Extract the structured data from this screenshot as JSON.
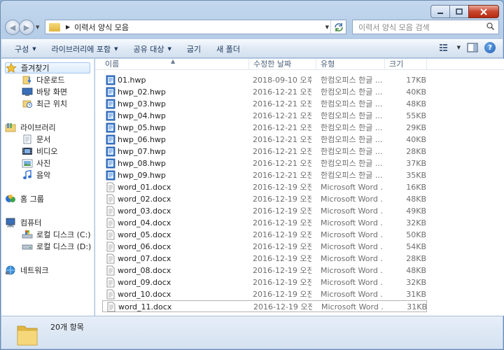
{
  "window": {
    "address_path": "이력서 양식 모음",
    "search_placeholder": "이력서 양식 모음 검색"
  },
  "toolbar": [
    {
      "label": "구성",
      "has_menu": true
    },
    {
      "label": "라이브러리에 포함",
      "has_menu": true
    },
    {
      "label": "공유 대상",
      "has_menu": true
    },
    {
      "label": "굽기",
      "has_menu": false
    },
    {
      "label": "새 폴더",
      "has_menu": false
    }
  ],
  "navigation": {
    "favorites": {
      "label": "즐겨찾기",
      "icon": "star-icon",
      "items": [
        {
          "label": "다운로드",
          "icon": "downloads-icon"
        },
        {
          "label": "바탕 화면",
          "icon": "desktop-icon"
        },
        {
          "label": "최근 위치",
          "icon": "recent-places-icon"
        }
      ]
    },
    "libraries": {
      "label": "라이브러리",
      "icon": "library-icon",
      "items": [
        {
          "label": "문서",
          "icon": "documents-icon"
        },
        {
          "label": "비디오",
          "icon": "videos-icon"
        },
        {
          "label": "사진",
          "icon": "pictures-icon"
        },
        {
          "label": "음악",
          "icon": "music-icon"
        }
      ]
    },
    "homegroup": {
      "label": "홈 그룹",
      "icon": "homegroup-icon"
    },
    "computer": {
      "label": "컴퓨터",
      "icon": "computer-icon",
      "items": [
        {
          "label": "로컬 디스크 (C:)",
          "icon": "system-drive-icon"
        },
        {
          "label": "로컬 디스크 (D:)",
          "icon": "drive-icon"
        }
      ]
    },
    "network": {
      "label": "네트워크",
      "icon": "network-icon"
    }
  },
  "columns": {
    "name": "이름",
    "date": "수정한 날짜",
    "type": "유형",
    "size": "크기"
  },
  "files": [
    {
      "name": "01.hwp",
      "date": "2018-09-10 오후 ...",
      "type": "한컴오피스 한글 ...",
      "size": "17KB",
      "icon": "hwp-file-icon"
    },
    {
      "name": "hwp_02.hwp",
      "date": "2016-12-21 오전 ...",
      "type": "한컴오피스 한글 ...",
      "size": "40KB",
      "icon": "hwp-file-icon"
    },
    {
      "name": "hwp_03.hwp",
      "date": "2016-12-21 오전 ...",
      "type": "한컴오피스 한글 ...",
      "size": "48KB",
      "icon": "hwp-file-icon"
    },
    {
      "name": "hwp_04.hwp",
      "date": "2016-12-21 오전 ...",
      "type": "한컴오피스 한글 ...",
      "size": "55KB",
      "icon": "hwp-file-icon"
    },
    {
      "name": "hwp_05.hwp",
      "date": "2016-12-21 오전 ...",
      "type": "한컴오피스 한글 ...",
      "size": "29KB",
      "icon": "hwp-file-icon"
    },
    {
      "name": "hwp_06.hwp",
      "date": "2016-12-21 오전 ...",
      "type": "한컴오피스 한글 ...",
      "size": "40KB",
      "icon": "hwp-file-icon"
    },
    {
      "name": "hwp_07.hwp",
      "date": "2016-12-21 오전 ...",
      "type": "한컴오피스 한글 ...",
      "size": "28KB",
      "icon": "hwp-file-icon"
    },
    {
      "name": "hwp_08.hwp",
      "date": "2016-12-21 오전 ...",
      "type": "한컴오피스 한글 ...",
      "size": "37KB",
      "icon": "hwp-file-icon"
    },
    {
      "name": "hwp_09.hwp",
      "date": "2016-12-21 오전 ...",
      "type": "한컴오피스 한글 ...",
      "size": "35KB",
      "icon": "hwp-file-icon"
    },
    {
      "name": "word_01.docx",
      "date": "2016-12-19 오전 ...",
      "type": "Microsoft Word ...",
      "size": "16KB",
      "icon": "docx-file-icon"
    },
    {
      "name": "word_02.docx",
      "date": "2016-12-19 오전 ...",
      "type": "Microsoft Word ...",
      "size": "48KB",
      "icon": "docx-file-icon"
    },
    {
      "name": "word_03.docx",
      "date": "2016-12-19 오전 ...",
      "type": "Microsoft Word ...",
      "size": "49KB",
      "icon": "docx-file-icon"
    },
    {
      "name": "word_04.docx",
      "date": "2016-12-19 오전 ...",
      "type": "Microsoft Word ...",
      "size": "32KB",
      "icon": "docx-file-icon"
    },
    {
      "name": "word_05.docx",
      "date": "2016-12-19 오전 ...",
      "type": "Microsoft Word ...",
      "size": "50KB",
      "icon": "docx-file-icon"
    },
    {
      "name": "word_06.docx",
      "date": "2016-12-19 오전 ...",
      "type": "Microsoft Word ...",
      "size": "54KB",
      "icon": "docx-file-icon"
    },
    {
      "name": "word_07.docx",
      "date": "2016-12-19 오전 ...",
      "type": "Microsoft Word ...",
      "size": "28KB",
      "icon": "docx-file-icon"
    },
    {
      "name": "word_08.docx",
      "date": "2016-12-19 오전 ...",
      "type": "Microsoft Word ...",
      "size": "48KB",
      "icon": "docx-file-icon"
    },
    {
      "name": "word_09.docx",
      "date": "2016-12-19 오전 ...",
      "type": "Microsoft Word ...",
      "size": "32KB",
      "icon": "docx-file-icon"
    },
    {
      "name": "word_10.docx",
      "date": "2016-12-19 오전 ...",
      "type": "Microsoft Word ...",
      "size": "31KB",
      "icon": "docx-file-icon"
    },
    {
      "name": "word_11.docx",
      "date": "2016-12-19 오전 ...",
      "type": "Microsoft Word ...",
      "size": "31KB",
      "icon": "docx-file-icon",
      "focused": true
    }
  ],
  "status": {
    "item_count": "20개 항목"
  },
  "colors": {
    "accent": "#3f6fa8",
    "window_frame": "#b3cbe6",
    "selection_border": "#a5c7f0"
  }
}
